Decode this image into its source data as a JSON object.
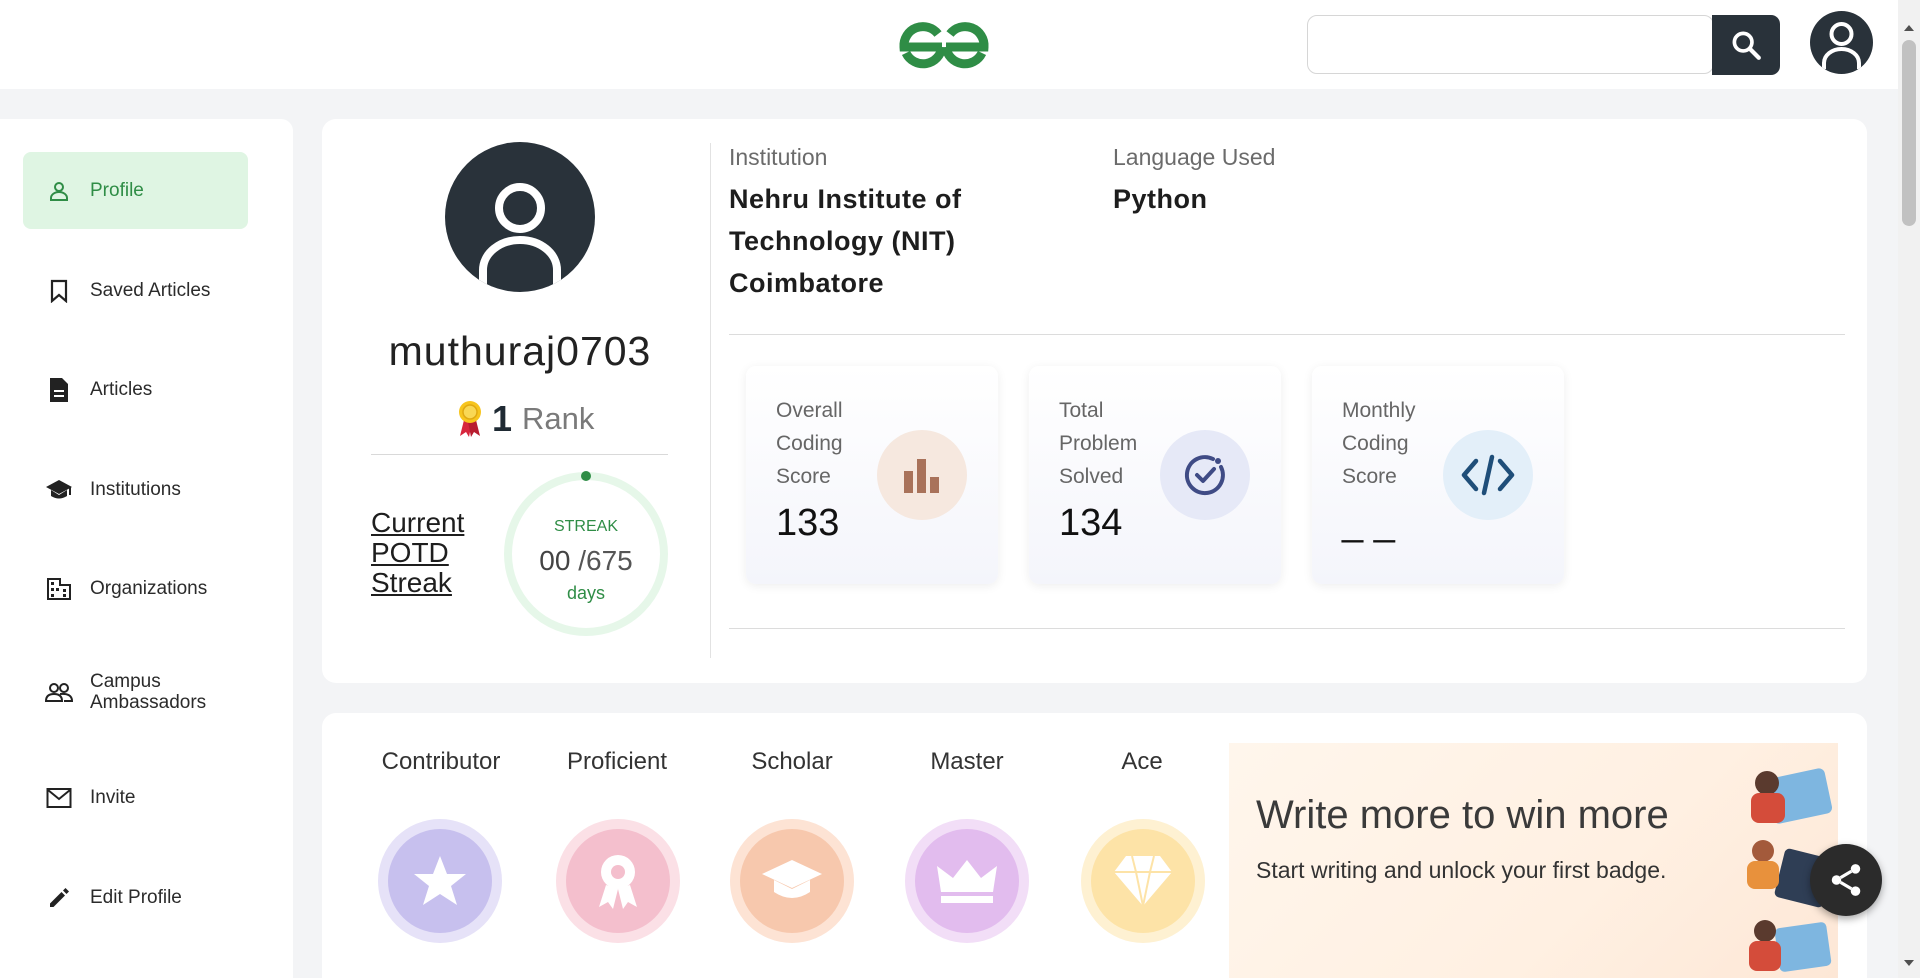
{
  "header": {
    "logo_alt": "GeeksforGeeks",
    "search": {
      "placeholder": "",
      "value": ""
    }
  },
  "sidebar": {
    "items": [
      {
        "label": "Profile",
        "icon": "user-icon",
        "active": true
      },
      {
        "label": "Saved Articles",
        "icon": "bookmark-icon",
        "active": false
      },
      {
        "label": "Articles",
        "icon": "document-icon",
        "active": false
      },
      {
        "label": "Institutions",
        "icon": "graduation-cap-icon",
        "active": false
      },
      {
        "label": "Organizations",
        "icon": "building-icon",
        "active": false
      },
      {
        "label": "Campus Ambassadors",
        "icon": "people-icon",
        "active": false
      },
      {
        "label": "Invite",
        "icon": "mail-icon",
        "active": false
      },
      {
        "label": "Edit Profile",
        "icon": "pencil-icon",
        "active": false
      }
    ]
  },
  "profile": {
    "username": "muthuraj0703",
    "rank_number": "1",
    "rank_label": "Rank",
    "streak_link": "Current POTD Streak",
    "streak": {
      "title": "STREAK",
      "current": "00",
      "total": "/675",
      "unit": "days"
    },
    "institution_label": "Institution",
    "institution_value": "Nehru Institute of Technology (NIT) Coimbatore",
    "institution_lines": [
      "Nehru Institute of",
      "Technology (NIT)",
      "Coimbatore"
    ],
    "language_label": "Language Used",
    "language_value": "Python"
  },
  "stats": [
    {
      "label_lines": [
        "Overall",
        "Coding",
        "Score"
      ],
      "value": "133",
      "icon": "bar-chart-icon",
      "icon_bg": "#f6e8df",
      "icon_color": "#a9725a"
    },
    {
      "label_lines": [
        "Total",
        "Problem",
        "Solved"
      ],
      "value": "134",
      "icon": "check-circle-icon",
      "icon_bg": "#e6e9f7",
      "icon_color": "#3f4b85"
    },
    {
      "label_lines": [
        "Monthly",
        "Coding",
        "Score"
      ],
      "value": "_ _",
      "icon": "code-icon",
      "icon_bg": "#e3eff9",
      "icon_color": "#1f4e79"
    }
  ],
  "badges": [
    {
      "name": "Contributor",
      "icon": "star-icon",
      "color": "#c7c0ee",
      "ring": "#e6e2f8"
    },
    {
      "name": "Proficient",
      "icon": "award-icon",
      "color": "#f4bfcd",
      "ring": "#fbe0e6"
    },
    {
      "name": "Scholar",
      "icon": "graduation-cap-icon",
      "color": "#f7c8ad",
      "ring": "#fde3d4"
    },
    {
      "name": "Master",
      "icon": "crown-icon",
      "color": "#e2bcee",
      "ring": "#f2def7"
    },
    {
      "name": "Ace",
      "icon": "diamond-icon",
      "color": "#fde3a7",
      "ring": "#fef1d2"
    }
  ],
  "promo": {
    "title": "Write more to win more",
    "subtitle": "Start writing and unlock your first badge."
  },
  "colors": {
    "brand_green": "#2f8d46",
    "dark": "#29323a",
    "active_bg": "#dff5e3"
  }
}
